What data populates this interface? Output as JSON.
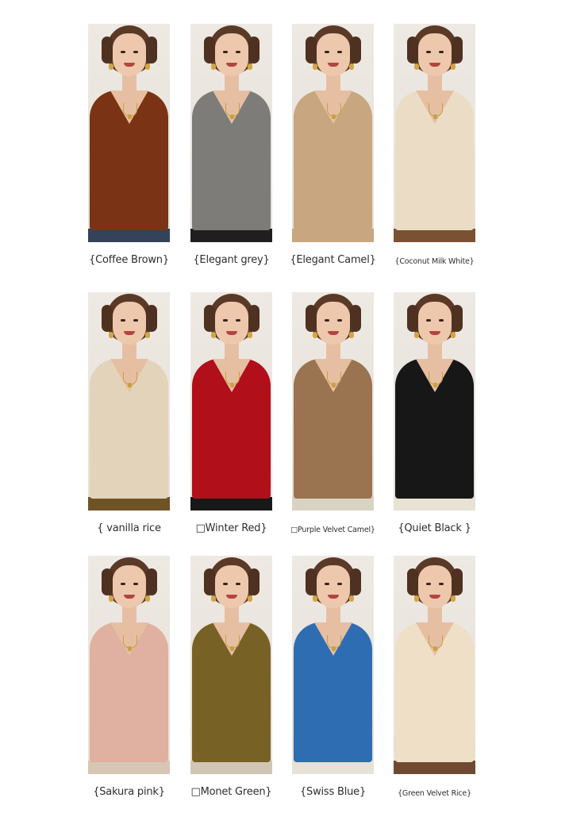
{
  "products": [
    {
      "caption": "{Coffee Brown}",
      "sweater": "#7a3415",
      "pants": "#34425a"
    },
    {
      "caption": "{Elegant grey}",
      "sweater": "#7d7c79",
      "pants": "#1f1f1f"
    },
    {
      "caption": "{Elegant Camel}",
      "sweater": "#c8a67f",
      "pants": "#c8a67f"
    },
    {
      "caption": "{Coconut Milk White}",
      "sweater": "#ebdcc6",
      "pants": "#7a5233"
    },
    {
      "caption": "{  vanilla rice",
      "sweater": "#e4d3bb",
      "pants": "#6e5327"
    },
    {
      "caption": "□Winter Red}",
      "sweater": "#b10f1a",
      "pants": "#181818"
    },
    {
      "caption": "□Purple Velvet Camel}",
      "sweater": "#9a7350",
      "pants": "#d9d3c4"
    },
    {
      "caption": "{Quiet Black  }",
      "sweater": "#171717",
      "pants": "#e8e2d4"
    },
    {
      "caption": "{Sakura pink}",
      "sweater": "#e0b0a0",
      "pants": "#d6c6b3"
    },
    {
      "caption": "□Monet Green}",
      "sweater": "#786125",
      "pants": "#d1c6b6"
    },
    {
      "caption": "{Swiss Blue}",
      "sweater": "#2f6db3",
      "pants": "#e6e2d6"
    },
    {
      "caption": "{Green Velvet Rice}",
      "sweater": "#eedfc6",
      "pants": "#6f4a30"
    }
  ]
}
